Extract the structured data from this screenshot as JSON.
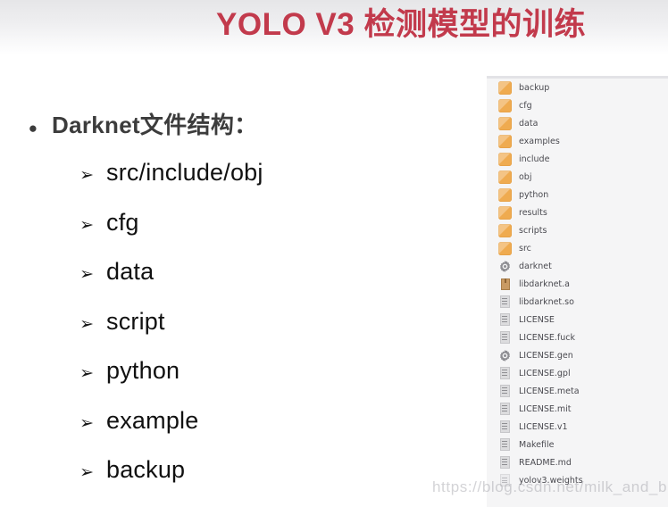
{
  "slide": {
    "title": "YOLO V3 检测模型的训练",
    "title_color": "#c23a4c",
    "watermark": "https://blog.csdn.net/milk_and_bread"
  },
  "outline": {
    "bullet_glyph": "●",
    "sub_glyph": "➢",
    "heading": "Darknet文件结构：",
    "items": [
      {
        "label": "src/include/obj"
      },
      {
        "label": "cfg"
      },
      {
        "label": "data"
      },
      {
        "label": "script"
      },
      {
        "label": "python"
      },
      {
        "label": "example"
      },
      {
        "label": "backup"
      }
    ]
  },
  "file_panel": {
    "background": "#f5f5f6",
    "entries": [
      {
        "name": "backup",
        "icon": "folder-icon"
      },
      {
        "name": "cfg",
        "icon": "folder-icon"
      },
      {
        "name": "data",
        "icon": "folder-icon"
      },
      {
        "name": "examples",
        "icon": "folder-icon"
      },
      {
        "name": "include",
        "icon": "folder-icon"
      },
      {
        "name": "obj",
        "icon": "folder-icon"
      },
      {
        "name": "python",
        "icon": "folder-icon"
      },
      {
        "name": "results",
        "icon": "folder-icon"
      },
      {
        "name": "scripts",
        "icon": "folder-icon"
      },
      {
        "name": "src",
        "icon": "folder-icon"
      },
      {
        "name": "darknet",
        "icon": "gear-icon"
      },
      {
        "name": "libdarknet.a",
        "icon": "archive-icon"
      },
      {
        "name": "libdarknet.so",
        "icon": "document-icon"
      },
      {
        "name": "LICENSE",
        "icon": "document-icon"
      },
      {
        "name": "LICENSE.fuck",
        "icon": "document-icon"
      },
      {
        "name": "LICENSE.gen",
        "icon": "gear-icon"
      },
      {
        "name": "LICENSE.gpl",
        "icon": "document-icon"
      },
      {
        "name": "LICENSE.meta",
        "icon": "document-icon"
      },
      {
        "name": "LICENSE.mit",
        "icon": "document-icon"
      },
      {
        "name": "LICENSE.v1",
        "icon": "document-icon"
      },
      {
        "name": "Makefile",
        "icon": "document-icon"
      },
      {
        "name": "README.md",
        "icon": "document-icon"
      },
      {
        "name": "yolov3.weights",
        "icon": "binary-icon"
      }
    ]
  }
}
